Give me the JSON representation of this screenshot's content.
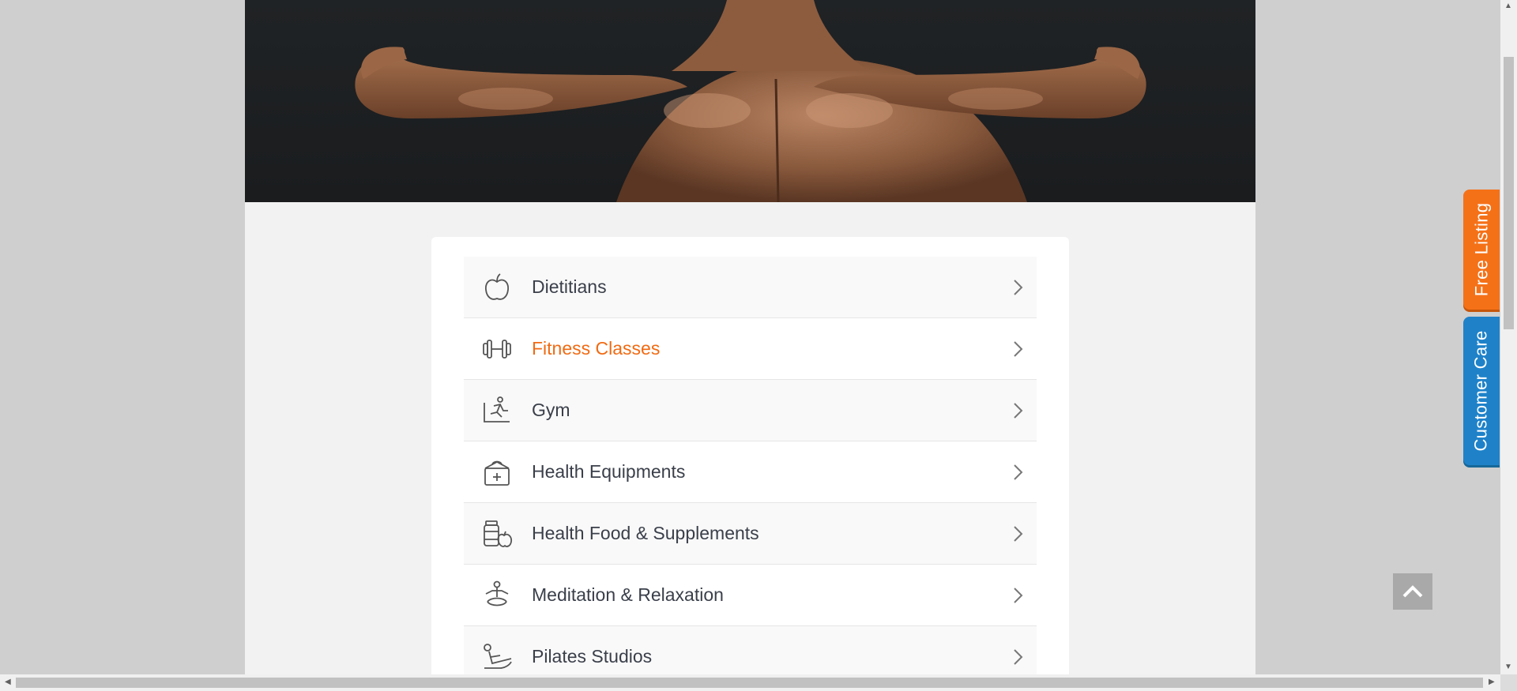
{
  "hero": {
    "image": "muscular-back-photo"
  },
  "categories": [
    {
      "label": "Dietitians",
      "icon": "apple-icon",
      "active": false
    },
    {
      "label": "Fitness Classes",
      "icon": "dumbbell-icon",
      "active": true
    },
    {
      "label": "Gym",
      "icon": "treadmill-runner-icon",
      "active": false
    },
    {
      "label": "Health Equipments",
      "icon": "medical-kit-icon",
      "active": false
    },
    {
      "label": "Health Food & Supplements",
      "icon": "supplements-jar-icon",
      "active": false
    },
    {
      "label": "Meditation & Relaxation",
      "icon": "meditation-icon",
      "active": false
    },
    {
      "label": "Pilates Studios",
      "icon": "pilates-icon",
      "active": false
    }
  ],
  "side_tabs": {
    "free_listing": "Free Listing",
    "customer_care": "Customer Care"
  },
  "colors": {
    "accent": "#f16a12",
    "free_listing_bg": "#f57118",
    "customer_care_bg": "#1f82c9",
    "text": "#3a3f4a"
  },
  "icons": {
    "scroll_top": "chevron-up-icon",
    "row_arrow": "chevron-right-icon"
  }
}
